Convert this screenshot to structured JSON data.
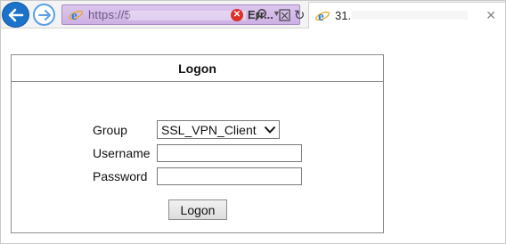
{
  "browser": {
    "address_bar": {
      "url_text": "https://5",
      "url_suffix": ","
    },
    "error_tab_label": "Err...",
    "active_tab": {
      "title": "31."
    },
    "colors": {
      "back_button": "#1a72c9",
      "address_bar_tint": "#d4b9ea",
      "error_icon": "#d9322b"
    },
    "icons": [
      "back-arrow-icon",
      "forward-arrow-icon",
      "ie-logo-icon",
      "search-icon",
      "dropdown-icon",
      "error-icon",
      "compatibility-view-icon",
      "refresh-icon",
      "close-icon"
    ]
  },
  "logon": {
    "title": "Logon",
    "group_label": "Group",
    "group_value": "SSL_VPN_Client",
    "username_label": "Username",
    "username_value": "",
    "password_label": "Password",
    "password_value": "",
    "button_label": "Logon"
  }
}
